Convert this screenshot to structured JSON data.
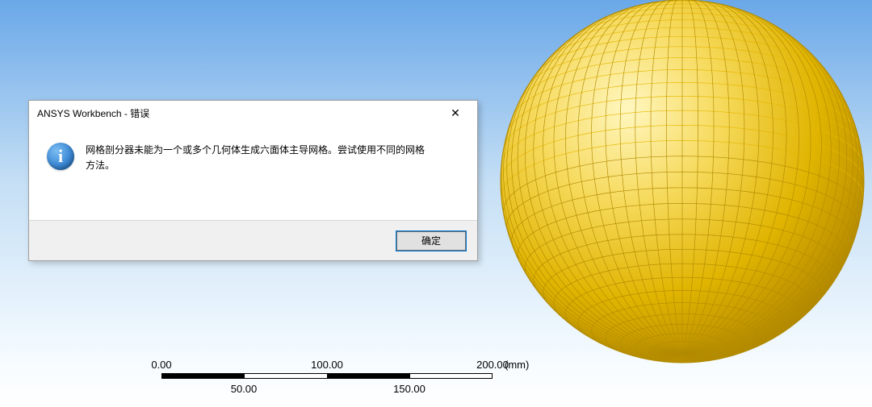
{
  "dialog": {
    "title": "ANSYS Workbench - 错误",
    "message": "网格剖分器未能为一个或多个几何体生成六面体主导网格。尝试使用不同的网格方法。",
    "ok_label": "确定",
    "close_symbol": "✕",
    "info_symbol": "i"
  },
  "scalebar": {
    "top0": "0.00",
    "top1": "100.00",
    "top2": "200.00",
    "bot0": "50.00",
    "bot1": "150.00",
    "unit": "(mm)"
  },
  "viewport": {
    "mesh_color": "#e6b800",
    "mesh_shadow": "#b28b00"
  }
}
